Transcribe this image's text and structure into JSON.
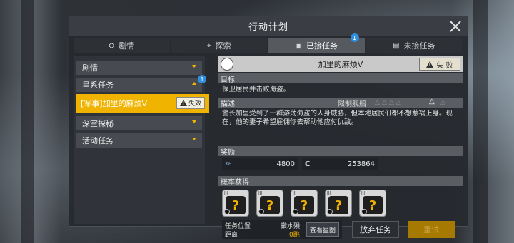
{
  "window": {
    "title": "行动计划"
  },
  "tabs": [
    {
      "label": "剧情",
      "icon": "theater-icon"
    },
    {
      "label": "探索",
      "icon": "explore-icon"
    },
    {
      "label": "已接任务",
      "icon": "task-accepted-icon",
      "badge": "1"
    },
    {
      "label": "未接任务",
      "icon": "task-list-icon"
    }
  ],
  "sidebar": {
    "items": [
      {
        "label": "剧情"
      },
      {
        "label": "星系任务",
        "badge": "1"
      },
      {
        "label": "[军事]加里的麻烦V",
        "status": "失效"
      },
      {
        "label": "深空探秘"
      },
      {
        "label": "活动任务"
      }
    ]
  },
  "mission": {
    "title": "加里的麻烦V",
    "status": "失 败",
    "goal_label": "目标",
    "goal_text": "保卫居民并击败海盗。",
    "desc_label": "描述",
    "ship_limit_label": "限制舰船",
    "desc_text": "警长加里受到了一群游荡海盗的人身威胁，但本地居民们都不想惹祸上身。现在，他的妻子希望雇佣你去帮助他应付仇敌。",
    "reward_label": "奖励",
    "xp_label": "XP",
    "xp_value": "4800",
    "credit_label": "C",
    "credit_value": "253864",
    "drop_label": "概率获得",
    "location_label": "任务位置",
    "location_value": "鑽水殞",
    "distance_label": "距离",
    "distance_value": "0跳",
    "view_map_button": "查看星图",
    "abandon_button": "放弃任务",
    "retry_button": "重试"
  },
  "colors": {
    "accent": "#f0b400",
    "badge": "#2f8fdc"
  }
}
